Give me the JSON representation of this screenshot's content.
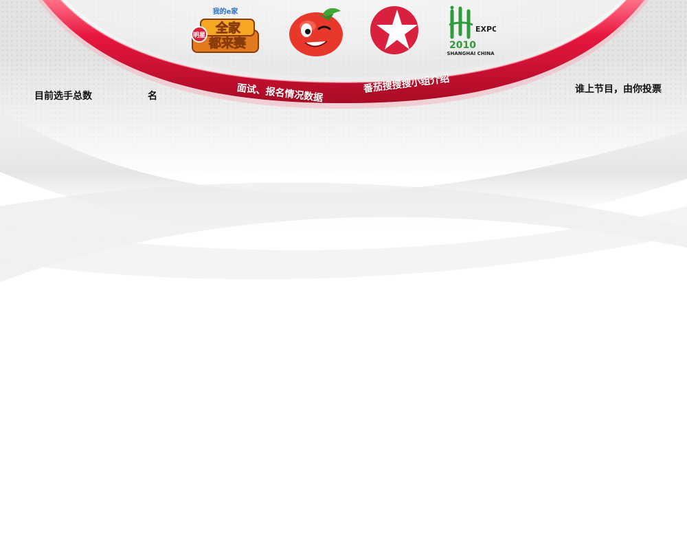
{
  "logos": {
    "family_show": {
      "top_text": "我的e家",
      "badge_text": "明星",
      "title_line1": "全家",
      "title_line2": "都来赛"
    },
    "expo": {
      "year_text": "2010",
      "name": "EXPO",
      "city": "SHANGHAI CHINA"
    }
  },
  "nav": {
    "interview_data": "面试、报名情况数据",
    "group_intro": "番茄搜搜搜小组介绍"
  },
  "stats": {
    "total_label": "目前选手总数",
    "total_value": "",
    "unit": "名"
  },
  "vote": {
    "label": "谁上节目，由你投票"
  },
  "colors": {
    "arc_red": "#e21a3f",
    "arc_dark": "#c8102e",
    "star_badge": "#d9213f",
    "expo_green": "#2e9c3a",
    "tomato": "#e8382c"
  }
}
